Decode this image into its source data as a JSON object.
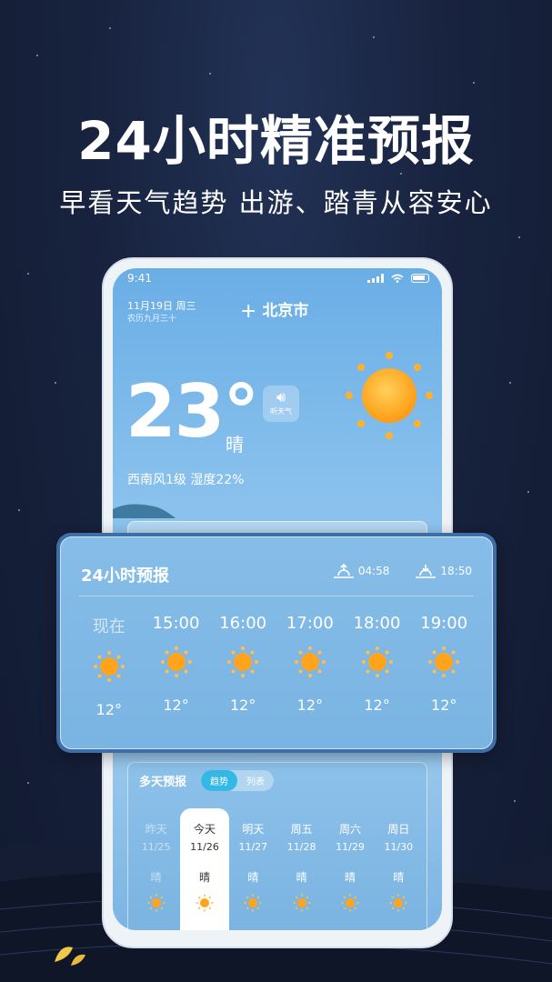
{
  "promo": {
    "headline": "24小时精准预报",
    "subline": "早看天气趋势 出游、踏青从容安心"
  },
  "status_bar": {
    "time": "9:41"
  },
  "header": {
    "date": "11月19日 周三",
    "lunar": "农历九月三十",
    "city": "北京市",
    "add_icon": "plus-icon"
  },
  "current": {
    "temperature": "23°",
    "condition": "晴",
    "speak_label": "听天气",
    "wind_humidity": "西南风1级 湿度22%"
  },
  "hourly": {
    "title": "24小时预报",
    "sunrise": "04:58",
    "sunset": "18:50",
    "hours": [
      {
        "label": "现在",
        "temp": "12°"
      },
      {
        "label": "15:00",
        "temp": "12°"
      },
      {
        "label": "16:00",
        "temp": "12°"
      },
      {
        "label": "17:00",
        "temp": "12°"
      },
      {
        "label": "18:00",
        "temp": "12°"
      },
      {
        "label": "19:00",
        "temp": "12°"
      }
    ]
  },
  "multiday": {
    "title": "多天预报",
    "tabs": [
      "趋势",
      "列表"
    ],
    "days": [
      {
        "name": "昨天",
        "date": "11/25",
        "cond": "晴"
      },
      {
        "name": "今天",
        "date": "11/26",
        "cond": "晴"
      },
      {
        "name": "明天",
        "date": "11/27",
        "cond": "晴"
      },
      {
        "name": "周五",
        "date": "11/28",
        "cond": "晴"
      },
      {
        "name": "周六",
        "date": "11/29",
        "cond": "晴"
      },
      {
        "name": "周日",
        "date": "11/30",
        "cond": "晴"
      }
    ]
  },
  "colors": {
    "sun": "#ffa41c",
    "sky": "#7ab4e2",
    "night": "#18233f"
  }
}
